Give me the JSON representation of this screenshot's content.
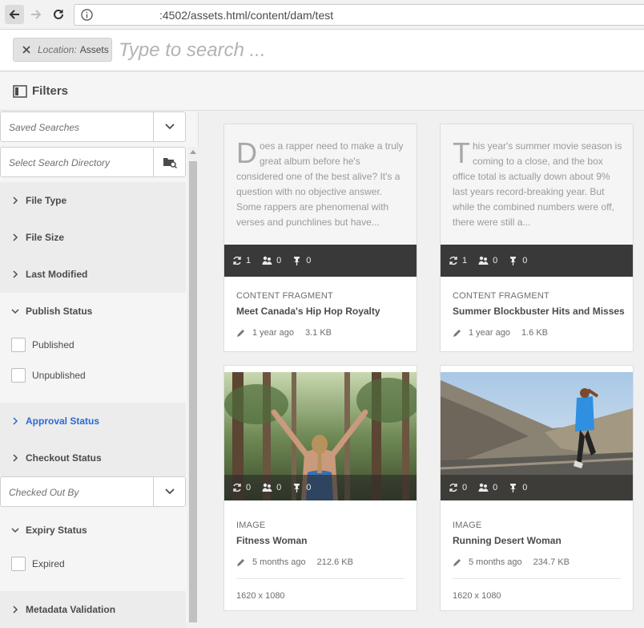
{
  "browser": {
    "url": ":4502/assets.html/content/dam/test"
  },
  "omnisearch": {
    "location_key": "Location:",
    "location_value": "Assets",
    "placeholder": "Type to search ..."
  },
  "filters": {
    "title": "Filters",
    "saved_searches": "Saved Searches",
    "search_directory": "Select Search Directory",
    "checked_out_by": "Checked Out By",
    "sections": {
      "file_type": "File Type",
      "file_size": "File Size",
      "last_modified": "Last Modified",
      "publish_status": "Publish Status",
      "approval_status": "Approval Status",
      "checkout_status": "Checkout Status",
      "expiry_status": "Expiry Status",
      "metadata_validation": "Metadata Validation"
    },
    "checkboxes": {
      "published": "Published",
      "unpublished": "Unpublished",
      "expired": "Expired"
    }
  },
  "cards": [
    {
      "type": "CONTENT FRAGMENT",
      "title": "Meet Canada's Hip Hop Royalty",
      "dropcap": "D",
      "excerpt": "oes a rapper need to make a truly great album before he's considered one of the best alive? It's a question with no objective answer. Some rappers are phenomenal with verses and punchlines but have...",
      "stats": {
        "versions": "1",
        "references": "0",
        "pins": "0"
      },
      "modified": "1 year ago",
      "size": "3.1 KB"
    },
    {
      "type": "CONTENT FRAGMENT",
      "title": "Summer Blockbuster Hits and Misses",
      "dropcap": "T",
      "excerpt": "his year's summer movie season is coming to a close, and the box office total is actually down about 9% last years record-breaking year. But while the combined numbers were off, there were still a...",
      "stats": {
        "versions": "1",
        "references": "0",
        "pins": "0"
      },
      "modified": "1 year ago",
      "size": "1.6 KB"
    },
    {
      "type": "IMAGE",
      "title": "Fitness Woman",
      "stats": {
        "versions": "0",
        "references": "0",
        "pins": "0"
      },
      "modified": "5 months ago",
      "size": "212.6 KB",
      "dimensions": "1620 x 1080"
    },
    {
      "type": "IMAGE",
      "title": "Running Desert Woman",
      "stats": {
        "versions": "0",
        "references": "0",
        "pins": "0"
      },
      "modified": "5 months ago",
      "size": "234.7 KB",
      "dimensions": "1620 x 1080"
    }
  ],
  "colors": {
    "accent_blue": "#2b6ad5",
    "card_bar": "#282828"
  }
}
